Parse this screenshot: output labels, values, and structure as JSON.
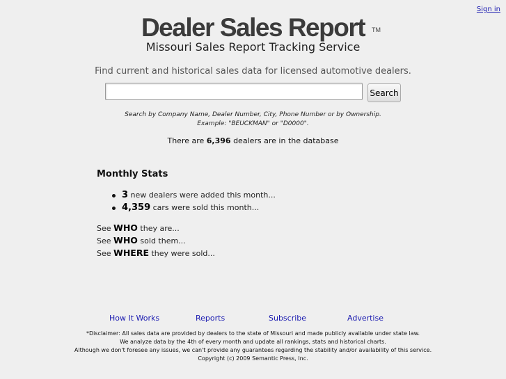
{
  "header": {
    "signin_label": "Sign in",
    "logo_text": "Dealer Sales Report",
    "logo_tm": "TM",
    "tagline": "Missouri Sales Report Tracking Service"
  },
  "search": {
    "intro": "Find current and historical sales data for licensed automotive dealers.",
    "value": "",
    "placeholder": "",
    "button_label": "Search",
    "hint_line1": "Search by Company Name, Dealer Number, City, Phone Number or by Ownership.",
    "hint_line2": "Example: \"BEUCKMAN\" or \"D0000\"."
  },
  "dealer_count": {
    "prefix": "There are",
    "number": "6,396",
    "suffix": "dealers are in the database"
  },
  "monthly_stats": {
    "title": "Monthly Stats",
    "items": [
      {
        "number": "3",
        "text": "new dealers were added this month..."
      },
      {
        "number": "4,359",
        "text": "cars were sold this month..."
      }
    ]
  },
  "see_links": [
    {
      "prefix": "See",
      "link": "WHO",
      "suffix": "they are..."
    },
    {
      "prefix": "See",
      "link": "WHO",
      "suffix": "sold them..."
    },
    {
      "prefix": "See",
      "link": "WHERE",
      "suffix": "they were sold..."
    }
  ],
  "footer": {
    "nav": [
      "How It Works",
      "Reports",
      "Subscribe",
      "Advertise"
    ],
    "link_color": "#1a1ab0",
    "disclaimer": [
      "*Disclaimer: All sales data are provided by dealers to the state of Missouri and made publicly available under state law.",
      "We analyze data by the 4th of every month and update all rankings, stats and historical charts.",
      "Although we don't foresee any issues, we can't provide any guarantees regarding the stability and/or availability of this service.",
      "Copyright (c) 2009 Semantic Press, Inc."
    ]
  }
}
